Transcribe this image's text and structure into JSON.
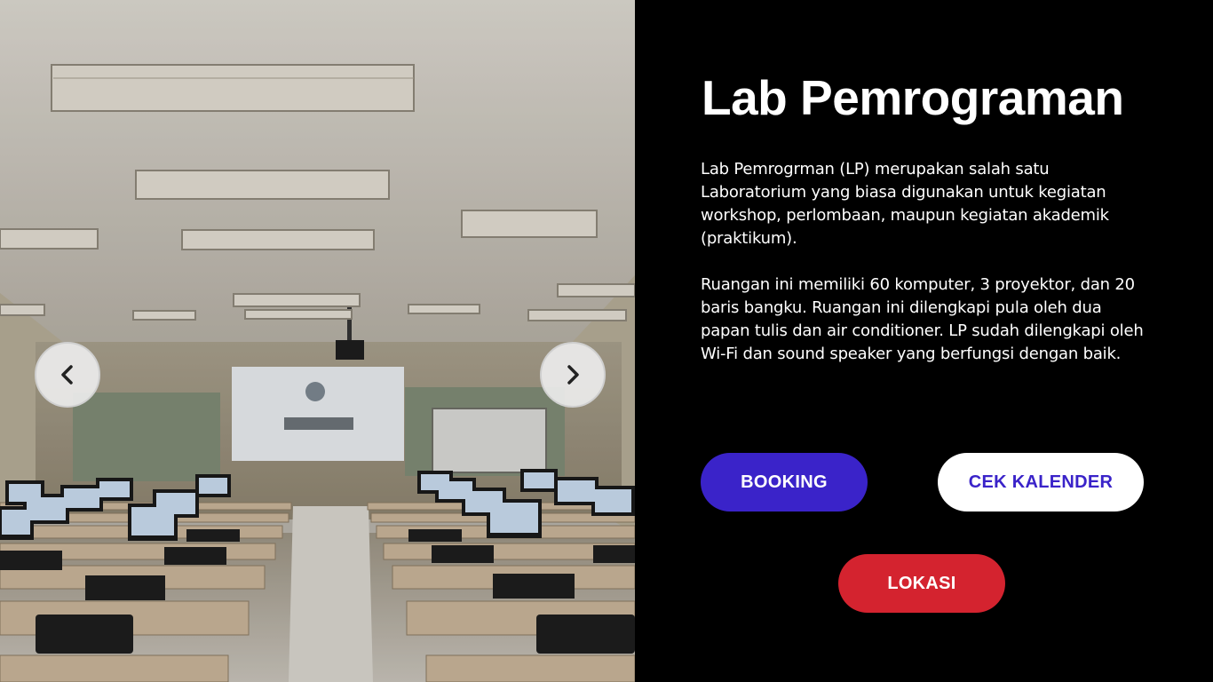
{
  "photo": {
    "description_icon": "classroom-photo",
    "prev_icon": "chevron-left-icon",
    "next_icon": "chevron-right-icon"
  },
  "info": {
    "title": "Lab Pemrograman",
    "paragraph1": "Lab Pemrogrman (LP) merupakan salah satu Laboratorium yang biasa digunakan untuk kegiatan workshop, perlombaan, maupun kegiatan akademik (praktikum).",
    "paragraph2": "Ruangan ini memiliki 60 komputer, 3 proyektor, dan 20 baris bangku. Ruangan ini dilengkapi pula oleh dua papan tulis dan air conditioner. LP sudah dilengkapi oleh Wi-Fi dan sound speaker yang berfungsi dengan baik."
  },
  "buttons": {
    "booking": "BOOKING",
    "cek_kalender": "CEK KALENDER",
    "lokasi": "LOKASI"
  },
  "colors": {
    "booking_bg": "#3a23c9",
    "kalender_text": "#3a23c9",
    "lokasi_bg": "#d4232f",
    "panel_bg": "#000000"
  }
}
